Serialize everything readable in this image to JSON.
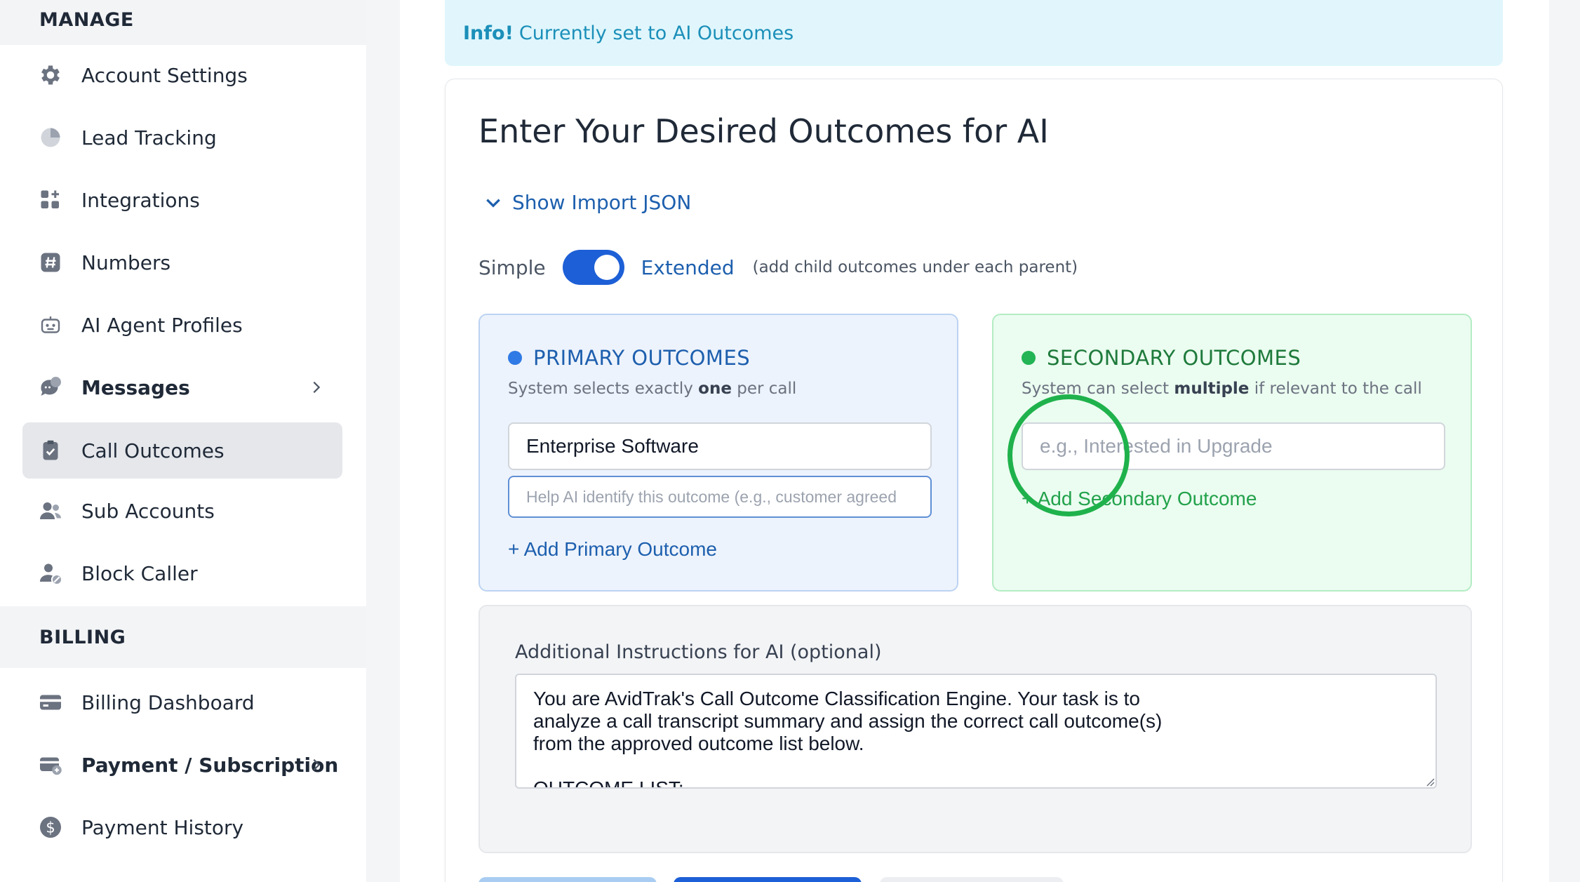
{
  "sidebar": {
    "manage_heading": "MANAGE",
    "billing_heading": "BILLING",
    "items": [
      {
        "label": "Account Settings",
        "icon": "gear-icon"
      },
      {
        "label": "Lead Tracking",
        "icon": "pie-chart-icon"
      },
      {
        "label": "Integrations",
        "icon": "apps-plus-icon"
      },
      {
        "label": "Numbers",
        "icon": "hash-icon"
      },
      {
        "label": "AI Agent Profiles",
        "icon": "robot-icon"
      },
      {
        "label": "Messages",
        "icon": "chat-icon"
      },
      {
        "label": "Call Outcomes",
        "icon": "clipboard-check-icon",
        "active": true
      },
      {
        "label": "Sub Accounts",
        "icon": "users-icon"
      },
      {
        "label": "Block Caller",
        "icon": "user-block-icon"
      }
    ],
    "billing_items": [
      {
        "label": "Billing Dashboard",
        "icon": "credit-card-icon"
      },
      {
        "label": "Payment / Subscription",
        "icon": "card-sync-icon"
      },
      {
        "label": "Payment History",
        "icon": "dollar-icon"
      }
    ]
  },
  "info": {
    "prefix": "Info!",
    "message": "Currently set to AI Outcomes"
  },
  "main": {
    "title": "Enter Your Desired Outcomes for AI",
    "import_toggle": "Show Import JSON",
    "mode": {
      "simple": "Simple",
      "extended": "Extended",
      "note": "(add child outcomes under each parent)",
      "value": "Extended"
    },
    "primary": {
      "heading": "PRIMARY OUTCOMES",
      "sub_before": "System selects exactly",
      "sub_bold": "one",
      "sub_after": "per call",
      "name_value": "Enterprise Software",
      "help_placeholder": "Help AI identify this outcome (e.g., customer agreed",
      "add_label": "+ Add Primary Outcome"
    },
    "secondary": {
      "heading": "SECONDARY OUTCOMES",
      "sub_before": "System can select",
      "sub_bold": "multiple",
      "sub_after": "if relevant to the call",
      "placeholder": "e.g., Interested in Upgrade",
      "add_label": "+ Add Secondary Outcome"
    },
    "instructions": {
      "label": "Additional Instructions for AI (optional)",
      "value": "You are AvidTrak's Call Outcome Classification Engine. Your task is to\nanalyze a call transcript summary and assign the correct call outcome(s)\nfrom the approved outcome list below.\n\nOUTCOME LIST:"
    }
  },
  "colors": {
    "accent": "#1d5fd6",
    "primary_text": "#1d5fae",
    "secondary_text": "#1e7a3b",
    "info_bg": "#e0f6fc",
    "click_ring": "#1fb24c"
  }
}
